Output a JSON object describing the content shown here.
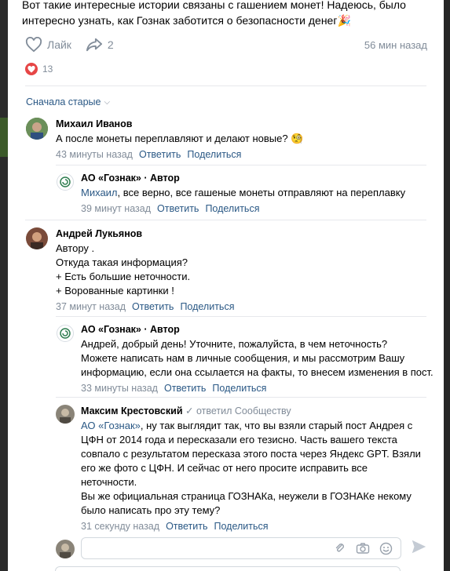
{
  "post": {
    "text_line1": "Вот такие интересные истории связаны с гашением монет! Надеюсь, было",
    "text_line2": "интересно узнать, как Гознак заботится о безопасности денег🎉",
    "like_label": "Лайк",
    "share_count": "2",
    "time": "56 мин назад",
    "reaction_count": "13"
  },
  "sort": {
    "label": "Сначала старые"
  },
  "comments": [
    {
      "name": "Михаил Иванов",
      "text": "А после монеты переплавляют и делают новые? 🧐",
      "time": "43 минуты назад",
      "reply_label": "Ответить",
      "share_label": "Поделиться"
    },
    {
      "name": "АО «Гознак»",
      "author_tag": " · Автор",
      "mention": "Михаил",
      "text": ", все верно, все гашеные монеты отправляют на переплавку",
      "time": "39 минут назад",
      "reply_label": "Ответить",
      "share_label": "Поделиться"
    },
    {
      "name": "Андрей Лукьянов",
      "lines": [
        "Автору .",
        "Откуда такая информация?",
        "+ Есть большие неточности.",
        "+ Ворованные картинки !"
      ],
      "time": "37 минут назад",
      "reply_label": "Ответить",
      "share_label": "Поделиться"
    },
    {
      "name": "АО «Гознак»",
      "author_tag": " · Автор",
      "lines": [
        "Андрей, добрый день! Уточните, пожалуйста, в чем неточность?",
        "Можете написать нам в личные сообщения, и мы рассмотрим Вашу",
        "информацию, если она ссылается на факты, то внесем изменения в пост."
      ],
      "time": "33 минуты назад",
      "reply_label": "Ответить",
      "share_label": "Поделиться"
    },
    {
      "name": "Максим Крестовский",
      "replied_to": "ответил Сообществу",
      "mention": "АО «Гознак»",
      "first_rest": ", ну так выглядит так, что вы взяли старый пост Андрея с",
      "lines": [
        "ЦФН от 2014 года и пересказали его тезисно. Часть вашего текста",
        "совпало с результатом пересказа этого поста через Яндекс GPT. Взяли",
        "его же фото с ЦФН. И сейчас от него просите исправить все",
        "неточности.",
        "Вы же официальная страница ГОЗНАКа, неужели в ГОЗНАКе некому",
        "было написать про эту тему?"
      ],
      "time": "31 секунду назад",
      "reply_label": "Ответить",
      "share_label": "Поделиться"
    }
  ],
  "colors": {
    "link": "#2a5885",
    "muted": "#818c99",
    "heart": "#e64646"
  }
}
